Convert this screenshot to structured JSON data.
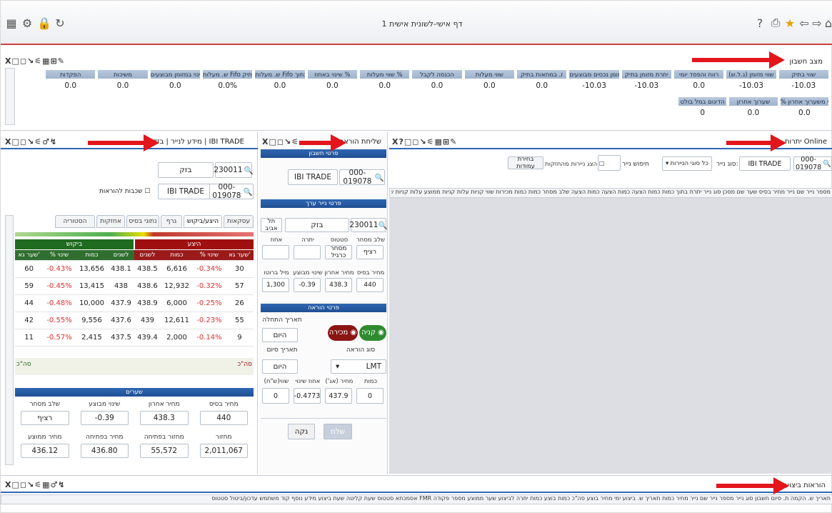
{
  "window": {
    "title": "דף אישי-לשונית אישית 1"
  },
  "account_panel": {
    "title": "מצב חשבון",
    "headers": [
      "שווי בתיק",
      "שווי מזומן (נ.ל.ש)",
      "רווח והפסד יומי",
      "יתרת מזומן בתיק",
      "מזומן נכסים מבוצעים",
      "ז. במחאות בתיק",
      "שווי מעלות",
      "הכנסה לקבל",
      "שווי מעלות %",
      "שינוי באחוז %",
      "ש. מעלות Fifo בתוך",
      "ש. מעלות Fifo בתיק %",
      "שינוי במזומן מבוצעים",
      "משיכות",
      "הפקדות"
    ],
    "values": [
      "-10.03",
      "-10.03",
      "0.0",
      "-10.03",
      "-10.03",
      "0.0",
      "0.0",
      "0.0",
      "0.0",
      "0.0",
      "0.0",
      "0.0%",
      "0.0",
      "0.0",
      "0.0"
    ],
    "row2_headers": [
      "% שינוי משערוך אחרון",
      "שערוך אחרון",
      "הדיגום במל בולט"
    ],
    "row2_values": [
      "0.0",
      "0.0",
      "0"
    ]
  },
  "online_panel": {
    "title": "יתרות Online",
    "account": "000-019078",
    "trade_label": "IBI TRADE",
    "security_type_label": "סוג נייר:",
    "security_type_value": "כל סוגי הניירות",
    "search_label": "חיפוש נייר",
    "checkbox_label": "הצג ניירות מהחזקות",
    "table_button": "בחירת עמודות",
    "columns": "מספר נייר שם נייר מחיר בסיס שער שם מסכן סוג נייר יתרת בתוך כמות כמות הצעה כמות הצעה כמות הצעה שלב מסחר כמות כמות מכירות שווי קניות עלות קניות ממוצע עלות קניות שווי מכירות שער בתוך שער שווי בתוך"
  },
  "order_panel": {
    "title": "שליחת הוראה",
    "section_account": "פרטי חשבון",
    "account": "000-019078",
    "trade": "IBI TRADE",
    "section_security": "פרטי נייר ערך",
    "security_number": "230011",
    "security_name": "בזק",
    "exchange": "תל אביב",
    "stats_labels": [
      "שלב מסחר",
      "סטטוס",
      "יתרה",
      "אחוז"
    ],
    "stats_values": [
      "רציף",
      "מסחר כרגיל",
      "",
      ""
    ],
    "price_labels": [
      "מחיר בסיס",
      "מחיר אחרון",
      "שינוי מבוצע",
      "מיל ברוטו"
    ],
    "price_values": [
      "440",
      "438.3",
      "-0.39",
      "1,300"
    ],
    "section_order": "פרטי הוראה",
    "buy_label": "קניה",
    "sell_label": "מכירה",
    "start_date_label": "תאריך התחלה",
    "start_date_value": "היום",
    "order_type_label": "סוג הוראה",
    "order_type_value": "LMT",
    "end_date_label": "תאריך סיום",
    "end_date_value": "היום",
    "qty_labels": [
      "כמות",
      "מחיר (אג')",
      "אחוז שינוי",
      "שווי(ש\"ח)"
    ],
    "qty_values": [
      "0",
      "437.9",
      "-0.4773",
      "0"
    ],
    "send_button": "שלח",
    "clear_button": "נקה"
  },
  "depth_panel": {
    "title": "מידע לנייר | בזק | IBI TRADE",
    "security_number": "230011",
    "security_name": "בזק",
    "account": "000-019078",
    "trade": "IBI TRADE",
    "checkbox_label": "שכבות להוראות",
    "tabs": [
      "עסקאות",
      "היצע/ביקוש",
      "גרף",
      "נתוני בסיס",
      "אחזקות",
      "הסטוריה"
    ],
    "bid_header": "ביקוש",
    "ask_header": "היצע",
    "table_headers": [
      "שער גא'",
      "% שינוי",
      "כמות",
      "לשנים",
      "לשנים",
      "כמות",
      "% שינוי",
      "שער גא'"
    ],
    "rows": [
      [
        "60",
        "-0.43%",
        "13,656",
        "438.1",
        "438.5",
        "6,616",
        "-0.34%",
        "30"
      ],
      [
        "59",
        "-0.45%",
        "13,415",
        "438",
        "438.6",
        "12,932",
        "-0.32%",
        "57"
      ],
      [
        "44",
        "-0.48%",
        "10,000",
        "437.9",
        "438.9",
        "6,000",
        "-0.25%",
        "26"
      ],
      [
        "42",
        "-0.55%",
        "9,556",
        "437.6",
        "439",
        "12,611",
        "-0.23%",
        "55"
      ],
      [
        "11",
        "-0.57%",
        "2,415",
        "437.5",
        "439.4",
        "2,000",
        "-0.14%",
        "9"
      ]
    ],
    "total_label_left": "סה\"כ",
    "total_label_right": "סה\"כ",
    "rates_header": "שערים",
    "rates_labels1": [
      "מחיר בסיס",
      "מחיר אחרון",
      "שינוי מבוצע",
      "שלב מסחר"
    ],
    "rates_values1": [
      "440",
      "438.3",
      "-0.39",
      "רציף"
    ],
    "rates_labels2": [
      "מחזור",
      "מחזור בפתיחה",
      "מחיר בפתיחה",
      "מחיר ממוצע"
    ],
    "rates_values2": [
      "2,011,067",
      "55,572",
      "436.80",
      "436.12"
    ]
  },
  "bottom_panel": {
    "title": "הוראות ביצועים",
    "columns": "תאריך ש. הקמה ת. סיום חשבון סוג נייר מספר נייר שם נייר מחיר כמות תאריך ש. ביצוע ימי מחיר בוצע סה\"כ כמות בוצע כמות יתרה לביצוע שער ממוצע מספר פקודה FMR אסמכתא סטטוס שעת קליטה שעת ביצוע מידע נוסף קוד משתמש עדכון/ביטול סטטוס"
  },
  "colors": {
    "arrow": "#e2161b",
    "header_blue": "#1f4f93",
    "ask_red": "#a01010",
    "bid_green": "#1f6b1f",
    "buy_green": "#2e8b2e",
    "sell_red": "#8b1515"
  }
}
